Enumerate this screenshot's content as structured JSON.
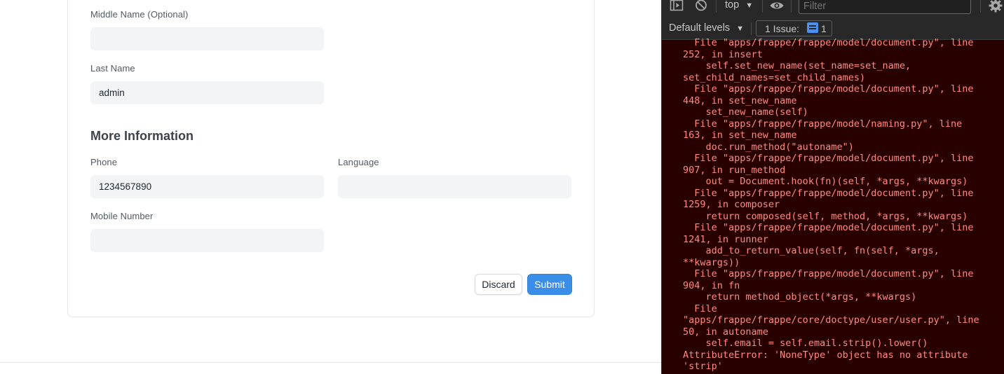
{
  "form": {
    "middle_name": {
      "label": "Middle Name (Optional)",
      "value": ""
    },
    "last_name": {
      "label": "Last Name",
      "value": "admin"
    },
    "more_information": {
      "title": "More Information",
      "phone": {
        "label": "Phone",
        "value": "1234567890"
      },
      "language": {
        "label": "Language",
        "value": ""
      },
      "mobile_number": {
        "label": "Mobile Number",
        "value": ""
      }
    },
    "actions": {
      "discard_label": "Discard",
      "submit_label": "Submit"
    }
  },
  "devtools": {
    "context_label": "top",
    "filter_placeholder": "Filter",
    "levels_label": "Default levels",
    "issues_label": "1 Issue:",
    "issues_count": "1",
    "icons": [
      "sidebar-toggle-icon",
      "clear-console-icon",
      "eye-icon",
      "gear-icon",
      "chat-icon"
    ],
    "console_text": "  File \"apps/frappe/frappe/model/document.py\", line\n252, in insert\n    self.set_new_name(set_name=set_name,\nset_child_names=set_child_names)\n  File \"apps/frappe/frappe/model/document.py\", line\n448, in set_new_name\n    set_new_name(self)\n  File \"apps/frappe/frappe/model/naming.py\", line\n163, in set_new_name\n    doc.run_method(\"autoname\")\n  File \"apps/frappe/frappe/model/document.py\", line\n907, in run_method\n    out = Document.hook(fn)(self, *args, **kwargs)\n  File \"apps/frappe/frappe/model/document.py\", line\n1259, in composer\n    return composed(self, method, *args, **kwargs)\n  File \"apps/frappe/frappe/model/document.py\", line\n1241, in runner\n    add_to_return_value(self, fn(self, *args,\n**kwargs))\n  File \"apps/frappe/frappe/model/document.py\", line\n904, in fn\n    return method_object(*args, **kwargs)\n  File\n\"apps/frappe/frappe/core/doctype/user/user.py\", line\n50, in autoname\n    self.email = self.email.strip().lower()\nAttributeError: 'NoneType' object has no attribute\n'strip'",
    "colors": {
      "console_bg": "#290000",
      "error_text": "#ff8a80",
      "accent": "#4b8ff0"
    }
  }
}
